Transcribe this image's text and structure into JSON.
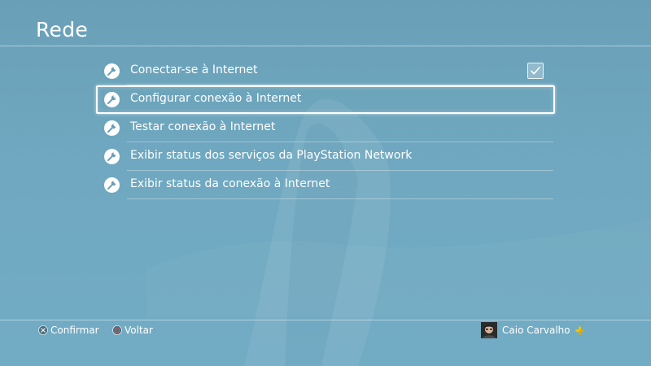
{
  "page": {
    "title": "Rede"
  },
  "menu": {
    "items": [
      {
        "label": "Conectar-se à Internet",
        "icon": "wrench-icon",
        "checked": true
      },
      {
        "label": "Configurar conexão à Internet",
        "icon": "wrench-icon",
        "selected": true
      },
      {
        "label": "Testar conexão à Internet",
        "icon": "wrench-icon"
      },
      {
        "label": "Exibir status dos serviços da PlayStation Network",
        "icon": "wrench-icon"
      },
      {
        "label": "Exibir status da conexão à Internet",
        "icon": "wrench-icon"
      }
    ]
  },
  "footer": {
    "confirm_label": "Confirmar",
    "confirm_icon": "cross-button-icon",
    "back_label": "Voltar",
    "back_icon": "circle-button-icon"
  },
  "user": {
    "name": "Caio Carvalho",
    "badge_icon": "playstation-plus-icon"
  },
  "colors": {
    "background": "#6fa8c0",
    "text": "#ffffff",
    "plus_gold": "#f5c400"
  }
}
